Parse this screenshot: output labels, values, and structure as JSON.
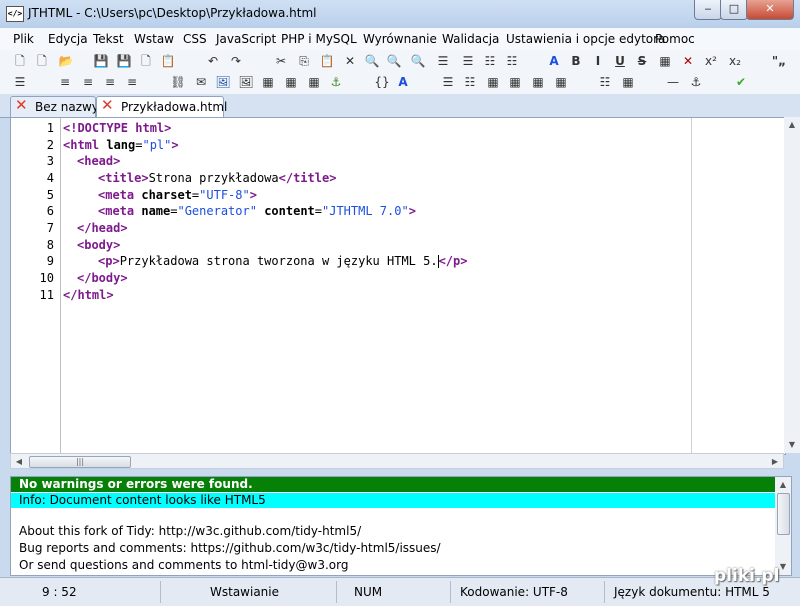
{
  "window": {
    "app_icon_text": "</>",
    "title": "JTHTML - C:\\Users\\pc\\Desktop\\Przykładowa.html",
    "btn_min": "‒",
    "btn_max": "□",
    "btn_close": "✕"
  },
  "menu": [
    "Plik",
    "Edycja",
    "Tekst",
    "Wstaw",
    "CSS",
    "JavaScript",
    "PHP i MySQL",
    "Wyrównanie",
    "Walidacja",
    "Ustawienia i opcje edytora",
    "Pomoc"
  ],
  "toolbar_glyphs": {
    "new": "🗋",
    "open": "📂",
    "save": "💾",
    "undo": "↶",
    "redo": "↷",
    "cut": "✂",
    "copy": "⎘",
    "paste": "📋",
    "delete": "✕",
    "find": "🔍",
    "bold": "B",
    "italic": "I",
    "underline": "U",
    "strike": "S",
    "sup": "x²",
    "sub": "x₂",
    "quote": "\"„",
    "align_left": "≡",
    "align_center": "≡",
    "align_right": "≡",
    "justify": "≡",
    "link": "⛓",
    "mail": "✉",
    "img": "🖼",
    "brace": "{}",
    "font": "A",
    "list_ul": "☰",
    "list_ol": "☷",
    "table": "▦",
    "hr": "—",
    "check": "✔",
    "anchor": "⚓"
  },
  "tabs": [
    {
      "label": "Bez nazwy",
      "active": false
    },
    {
      "label": "Przykładowa.html",
      "active": true
    }
  ],
  "code": {
    "line_numbers": [
      "1",
      "2",
      "3",
      "4",
      "5",
      "6",
      "7",
      "8",
      "9",
      "10",
      "11"
    ],
    "l1": {
      "tag": "<!DOCTYPE html>"
    },
    "l2": {
      "open": "<html",
      "attr": " lang",
      "eq": "=",
      "val": "\"pl\"",
      "close": ">"
    },
    "l3": {
      "tag": "<head>"
    },
    "l4": {
      "open": "<title>",
      "text": "Strona przykładowa",
      "close": "</title>"
    },
    "l5": {
      "open": "<meta",
      "attr": " charset",
      "eq": "=",
      "val": "\"UTF-8\"",
      "close": ">"
    },
    "l6": {
      "open": "<meta",
      "attr1": " name",
      "eq1": "=",
      "val1": "\"Generator\"",
      "attr2": " content",
      "eq2": "=",
      "val2": "\"JTHTML 7.0\"",
      "close": ">"
    },
    "l7": {
      "tag": "</head>"
    },
    "l8": {
      "tag": "<body>"
    },
    "l9": {
      "open": "<p>",
      "text": "Przykładowa strona tworzona w języku HTML 5.",
      "close": "</p>"
    },
    "l10": {
      "tag": "</body>"
    },
    "l11": {
      "tag": "</html>"
    }
  },
  "output": {
    "status": "No warnings or errors were found.",
    "info": "Info: Document content looks like HTML5",
    "lines": [
      "About this fork of Tidy: http://w3c.github.com/tidy-html5/",
      "Bug reports and comments: https://github.com/w3c/tidy-html5/issues/",
      "Or send questions and comments to html-tidy@w3.org"
    ]
  },
  "status": {
    "position": "9 : 52",
    "mode": "Wstawianie",
    "num": "NUM",
    "encoding": "Kodowanie: UTF-8",
    "doc_lang": "Język dokumentu: HTML 5"
  },
  "watermark": "pliki.pl",
  "hscroll_grip": "|||",
  "colors": {
    "tag": "#7d1a8c",
    "value": "#1c4ee0",
    "ok": "#068006",
    "info": "#00ffff"
  }
}
